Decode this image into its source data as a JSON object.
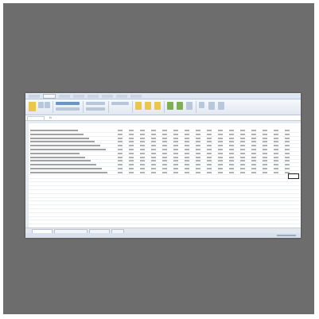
{
  "ribbon": {
    "tab_count": 8,
    "button_icons": [
      "paste-icon",
      "cut-icon",
      "copy-icon",
      "font-icon",
      "align-icon",
      "number-format-icon",
      "conditional-format-icon",
      "table-format-icon",
      "cell-styles-icon",
      "insert-icon",
      "delete-icon",
      "format-icon",
      "sum-icon",
      "sort-filter-icon",
      "find-icon"
    ]
  },
  "sheet": {
    "title": "",
    "row_count": 26
  },
  "sheet_tabs": [
    {
      "label": "",
      "active": true
    },
    {
      "label": "",
      "active": false
    },
    {
      "label": "",
      "active": false
    },
    {
      "label": "",
      "active": false
    }
  ]
}
